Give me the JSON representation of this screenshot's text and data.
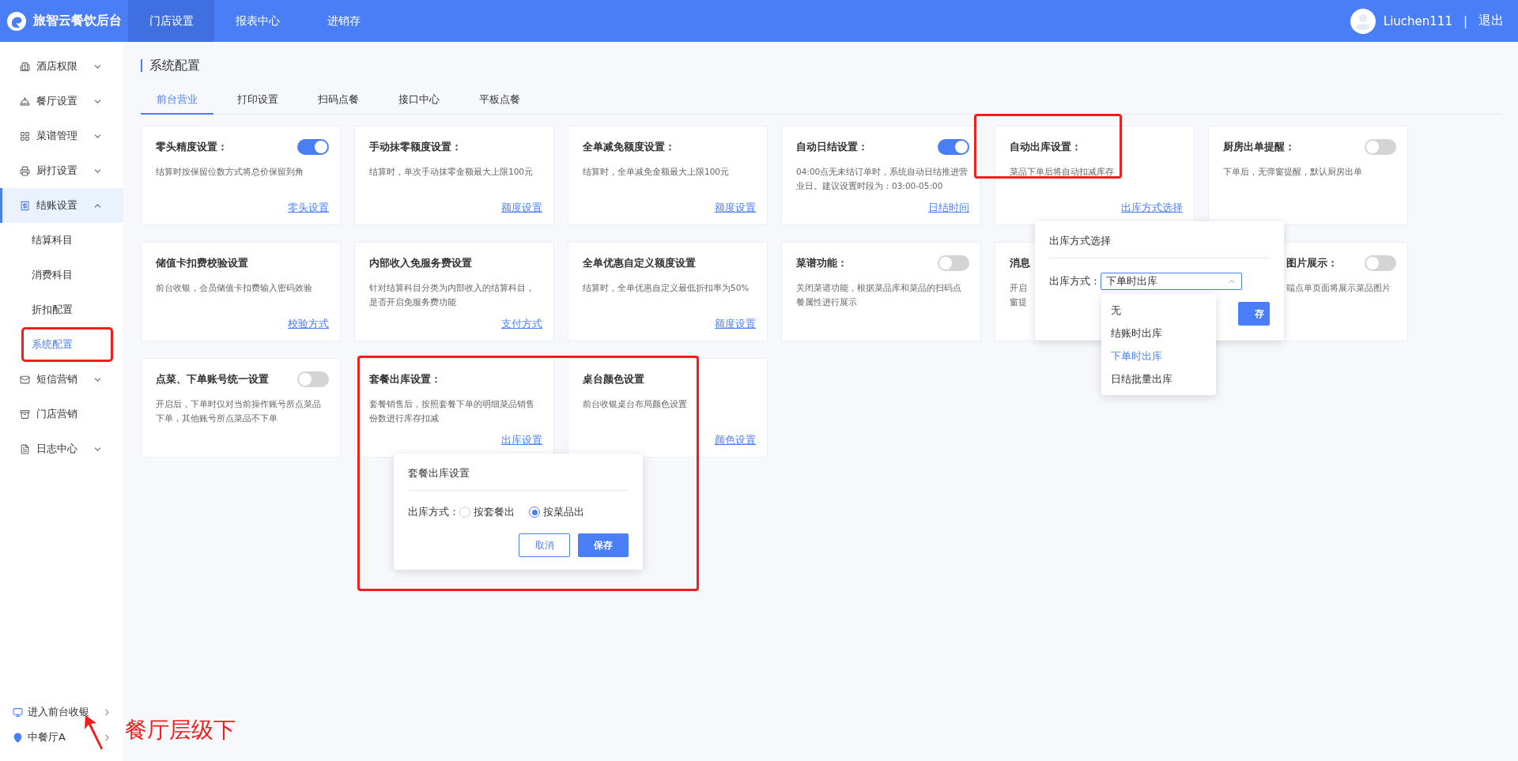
{
  "header": {
    "app_name": "旅智云餐饮后台",
    "nav": [
      {
        "label": "门店设置",
        "selected": true
      },
      {
        "label": "报表中心",
        "selected": false
      },
      {
        "label": "进销存",
        "selected": false
      }
    ],
    "user": "Liuchen111",
    "separator": "|",
    "logout": "退出"
  },
  "sidebar": {
    "items": [
      {
        "label": "酒店权限",
        "kind": "group",
        "expanded": false,
        "selected": false
      },
      {
        "label": "餐厅设置",
        "kind": "group",
        "expanded": false,
        "selected": false
      },
      {
        "label": "菜谱管理",
        "kind": "group",
        "expanded": false,
        "selected": false
      },
      {
        "label": "厨打设置",
        "kind": "group",
        "expanded": false,
        "selected": false
      },
      {
        "label": "结账设置",
        "kind": "group",
        "expanded": true,
        "selected": true,
        "children": [
          {
            "label": "结算科目",
            "selected": false,
            "annotated": false
          },
          {
            "label": "消费科目",
            "selected": false,
            "annotated": false
          },
          {
            "label": "折扣配置",
            "selected": false,
            "annotated": false
          },
          {
            "label": "系统配置",
            "selected": true,
            "annotated": true
          }
        ]
      },
      {
        "label": "短信营销",
        "kind": "group",
        "expanded": false,
        "selected": false
      },
      {
        "label": "门店营销",
        "kind": "link",
        "selected": false
      },
      {
        "label": "日志中心",
        "kind": "group",
        "expanded": false,
        "selected": false
      }
    ],
    "footer_links": [
      "进入前台收银",
      "中餐厅A"
    ]
  },
  "page": {
    "title": "系统配置",
    "tabs": [
      {
        "label": "前台营业",
        "selected": true
      },
      {
        "label": "打印设置",
        "selected": false
      },
      {
        "label": "扫码点餐",
        "selected": false
      },
      {
        "label": "接口中心",
        "selected": false
      },
      {
        "label": "平板点餐",
        "selected": false
      }
    ],
    "cards": [
      {
        "kind": "full",
        "title": "零头精度设置：",
        "toggle": {
          "on": true
        },
        "description": [
          "结算时按保留位数方式将总价保留到角"
        ],
        "link": "零头设置"
      },
      {
        "kind": "full",
        "title": "手动抹零额度设置：",
        "description": [
          "结算时，单次手动抹零金额最大上限100元"
        ],
        "link": "额度设置"
      },
      {
        "kind": "full",
        "title": "全单减免额度设置：",
        "description": [
          "结算时，全单减免金额最大上限100元"
        ],
        "link": "额度设置"
      },
      {
        "kind": "full",
        "title": "自动日结设置：",
        "toggle": {
          "on": true
        },
        "description": [
          "04:00点无未结订单时，系统自动日结推进营",
          "业日。建议设置时段为：03:00-05:00"
        ],
        "link": "日结时间"
      },
      {
        "kind": "full",
        "title": "自动出库设置：",
        "description": [
          "菜品下单后将自动扣减库存"
        ],
        "link": "出库方式选择",
        "annotated": true,
        "popover": {
          "kind": "select",
          "title": "出库方式选择",
          "field_label": "出库方式：",
          "value": "下单时出库",
          "expanded": true,
          "options": [
            {
              "label": "无",
              "selected": false
            },
            {
              "label": "结账时出库",
              "selected": false
            },
            {
              "label": "下单时出库",
              "selected": true
            },
            {
              "label": "日结批量出库",
              "selected": false
            }
          ],
          "save": "存"
        }
      },
      {
        "kind": "full",
        "title": "厨房出单提醒：",
        "toggle": {
          "on": false
        },
        "description": [
          "下单后，无弹窗提醒，默认厨房出单"
        ]
      },
      {
        "kind": "full",
        "title": "储值卡扣费校验设置",
        "description": [
          "前台收银，会员储值卡扣费输入密码效验"
        ],
        "link": "校验方式"
      },
      {
        "kind": "full",
        "title": "内部收入免服务费设置",
        "description": [
          "针对结算科目分类为内部收入的结算科目，",
          "是否开启免服务费功能"
        ],
        "link": "支付方式"
      },
      {
        "kind": "full",
        "title": "全单优惠自定义额度设置",
        "description": [
          "结算时，全单优惠自定义最低折扣率为50%"
        ],
        "link": "额度设置"
      },
      {
        "kind": "full",
        "title": "菜谱功能：",
        "toggle": {
          "on": false
        },
        "description": [
          "关闭菜谱功能，根据菜品库和菜品的扫码点",
          "餐属性进行展示"
        ]
      },
      {
        "kind": "full",
        "title": "消息",
        "description": [
          "开启",
          "窗提"
        ]
      },
      {
        "kind": "partial",
        "title": "图片展示：",
        "toggle": {
          "on": false
        },
        "description": [
          "端点单页面将展示菜品图片"
        ]
      },
      {
        "kind": "full",
        "title": "点菜、下单账号统一设置",
        "toggle": {
          "on": false
        },
        "description": [
          "开启后，下单时仅对当前操作账号所点菜品",
          "下单，其他账号所点菜品不下单"
        ]
      },
      {
        "kind": "full",
        "title": "套餐出库设置：",
        "description": [
          "套餐销售后，按照套餐下单的明细菜品销售",
          "份数进行库存扣减"
        ],
        "link": "出库设置",
        "annotated": true,
        "popover": {
          "kind": "radio",
          "title": "套餐出库设置",
          "field_label": "出库方式：",
          "options": [
            {
              "label": "按套餐出",
              "selected": false
            },
            {
              "label": "按菜品出",
              "selected": true
            }
          ],
          "cancel": "取消",
          "save": "保存"
        }
      },
      {
        "kind": "full",
        "title": "桌台颜色设置",
        "description": [
          "前台收银桌台布局颜色设置"
        ],
        "link": "颜色设置"
      }
    ]
  },
  "annotation_note": "餐厅层级下"
}
